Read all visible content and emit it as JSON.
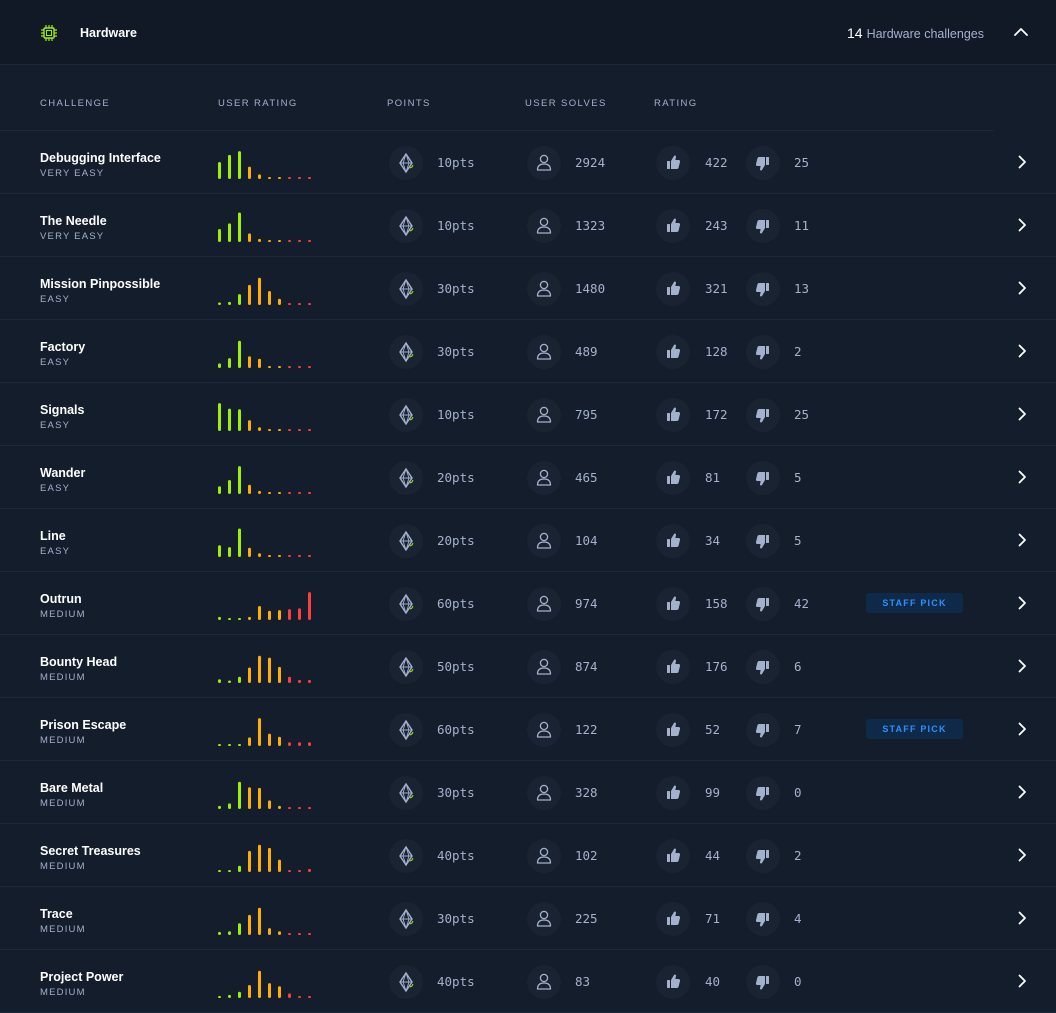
{
  "header": {
    "title": "Hardware",
    "count": "14",
    "count_label": "Hardware challenges"
  },
  "columns": {
    "challenge": "CHALLENGE",
    "user_rating": "USER RATING",
    "points": "POINTS",
    "user_solves": "USER SOLVES",
    "rating": "RATING"
  },
  "colors": {
    "green": "#9fef00",
    "orange": "#ffaf00",
    "red": "#ff3e3e",
    "muted": "#a4b1cd",
    "badge_text": "#2d8fff"
  },
  "icons": {
    "category": "chip-icon",
    "points": "diamond-icon",
    "solves": "user-icon",
    "like": "thumbs-up-icon",
    "dislike": "thumbs-down-icon",
    "open": "chevron-right-icon",
    "collapse": "chevron-up-icon"
  },
  "challenges": [
    {
      "name": "Debugging Interface",
      "difficulty": "VERY EASY",
      "points": "10pts",
      "solves": "2924",
      "likes": "422",
      "dislikes": "25",
      "staff_pick": "",
      "rating_dist": [
        0.55,
        0.78,
        0.9,
        0.4,
        0.15,
        0.05,
        0.05,
        0.05,
        0.05,
        0.05
      ]
    },
    {
      "name": "The Needle",
      "difficulty": "VERY EASY",
      "points": "10pts",
      "solves": "1323",
      "likes": "243",
      "dislikes": "11",
      "staff_pick": "",
      "rating_dist": [
        0.42,
        0.6,
        0.95,
        0.28,
        0.1,
        0.05,
        0.05,
        0.05,
        0.05,
        0.05
      ]
    },
    {
      "name": "Mission Pinpossible",
      "difficulty": "EASY",
      "points": "30pts",
      "solves": "1480",
      "likes": "321",
      "dislikes": "13",
      "staff_pick": "",
      "rating_dist": [
        0.08,
        0.1,
        0.35,
        0.65,
        0.88,
        0.45,
        0.2,
        0.05,
        0.05,
        0.05
      ]
    },
    {
      "name": "Factory",
      "difficulty": "EASY",
      "points": "30pts",
      "solves": "489",
      "likes": "128",
      "dislikes": "2",
      "staff_pick": "",
      "rating_dist": [
        0.15,
        0.32,
        0.88,
        0.38,
        0.3,
        0.05,
        0.05,
        0.05,
        0.05,
        0.05
      ]
    },
    {
      "name": "Signals",
      "difficulty": "EASY",
      "points": "10pts",
      "solves": "795",
      "likes": "172",
      "dislikes": "25",
      "staff_pick": "",
      "rating_dist": [
        0.9,
        0.72,
        0.7,
        0.35,
        0.12,
        0.05,
        0.05,
        0.05,
        0.05,
        0.05
      ]
    },
    {
      "name": "Wander",
      "difficulty": "EASY",
      "points": "20pts",
      "solves": "465",
      "likes": "81",
      "dislikes": "5",
      "staff_pick": "",
      "rating_dist": [
        0.25,
        0.45,
        0.9,
        0.3,
        0.1,
        0.05,
        0.05,
        0.05,
        0.05,
        0.05
      ]
    },
    {
      "name": "Line",
      "difficulty": "EASY",
      "points": "20pts",
      "solves": "104",
      "likes": "34",
      "dislikes": "5",
      "staff_pick": "",
      "rating_dist": [
        0.38,
        0.32,
        0.92,
        0.3,
        0.12,
        0.05,
        0.05,
        0.05,
        0.05,
        0.05
      ]
    },
    {
      "name": "Outrun",
      "difficulty": "MEDIUM",
      "points": "60pts",
      "solves": "974",
      "likes": "158",
      "dislikes": "42",
      "staff_pick": "STAFF PICK",
      "rating_dist": [
        0.1,
        0.06,
        0.06,
        0.1,
        0.45,
        0.3,
        0.32,
        0.35,
        0.38,
        0.9
      ]
    },
    {
      "name": "Bounty Head",
      "difficulty": "MEDIUM",
      "points": "50pts",
      "solves": "874",
      "likes": "176",
      "dislikes": "6",
      "staff_pick": "",
      "rating_dist": [
        0.12,
        0.08,
        0.2,
        0.5,
        0.88,
        0.82,
        0.52,
        0.2,
        0.1,
        0.1
      ]
    },
    {
      "name": "Prison Escape",
      "difficulty": "MEDIUM",
      "points": "60pts",
      "solves": "122",
      "likes": "52",
      "dislikes": "7",
      "staff_pick": "STAFF PICK",
      "rating_dist": [
        0.05,
        0.05,
        0.05,
        0.28,
        0.9,
        0.4,
        0.3,
        0.12,
        0.12,
        0.12
      ]
    },
    {
      "name": "Bare Metal",
      "difficulty": "MEDIUM",
      "points": "30pts",
      "solves": "328",
      "likes": "99",
      "dislikes": "0",
      "staff_pick": "",
      "rating_dist": [
        0.1,
        0.18,
        0.88,
        0.7,
        0.68,
        0.28,
        0.1,
        0.05,
        0.05,
        0.05
      ]
    },
    {
      "name": "Secret Treasures",
      "difficulty": "MEDIUM",
      "points": "40pts",
      "solves": "102",
      "likes": "44",
      "dislikes": "2",
      "staff_pick": "",
      "rating_dist": [
        0.05,
        0.05,
        0.2,
        0.68,
        0.88,
        0.78,
        0.4,
        0.05,
        0.05,
        0.1
      ]
    },
    {
      "name": "Trace",
      "difficulty": "MEDIUM",
      "points": "30pts",
      "solves": "225",
      "likes": "71",
      "dislikes": "4",
      "staff_pick": "",
      "rating_dist": [
        0.1,
        0.12,
        0.38,
        0.65,
        0.88,
        0.22,
        0.12,
        0.05,
        0.05,
        0.05
      ]
    },
    {
      "name": "Project Power",
      "difficulty": "MEDIUM",
      "points": "40pts",
      "solves": "83",
      "likes": "40",
      "dislikes": "0",
      "staff_pick": "",
      "rating_dist": [
        0.05,
        0.1,
        0.2,
        0.42,
        0.88,
        0.48,
        0.38,
        0.15,
        0.05,
        0.05
      ]
    }
  ]
}
